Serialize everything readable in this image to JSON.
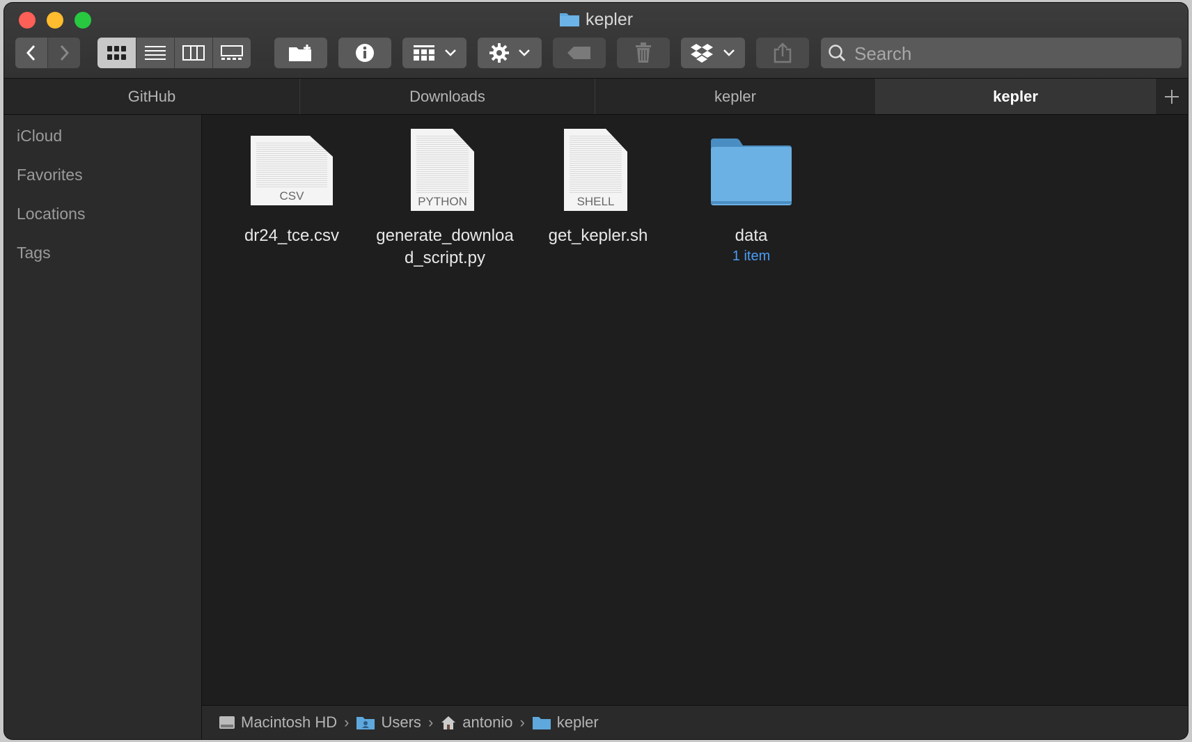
{
  "window": {
    "title": "kepler"
  },
  "toolbar": {
    "search_placeholder": "Search"
  },
  "tabs": [
    {
      "label": "GitHub"
    },
    {
      "label": "Downloads"
    },
    {
      "label": "kepler"
    },
    {
      "label": "kepler"
    }
  ],
  "sidebar": {
    "items": [
      {
        "label": "iCloud"
      },
      {
        "label": "Favorites"
      },
      {
        "label": "Locations"
      },
      {
        "label": "Tags"
      }
    ]
  },
  "files": [
    {
      "name": "dr24_tce.csv",
      "type_label": "CSV",
      "kind": "document"
    },
    {
      "name_line1": "generate_downloa",
      "name_line2": "d_script.py",
      "type_label": "PYTHON",
      "kind": "document"
    },
    {
      "name": "get_kepler.sh",
      "type_label": "SHELL",
      "kind": "document"
    },
    {
      "name": "data",
      "subtitle": "1 item",
      "kind": "folder"
    }
  ],
  "pathbar": [
    {
      "label": "Macintosh HD",
      "icon": "hard-drive-icon"
    },
    {
      "label": "Users",
      "icon": "users-folder-icon"
    },
    {
      "label": "antonio",
      "icon": "home-icon"
    },
    {
      "label": "kepler",
      "icon": "folder-icon"
    }
  ],
  "colors": {
    "folder_blue": "#5fa8dd",
    "accent": "#4a9cf7"
  }
}
